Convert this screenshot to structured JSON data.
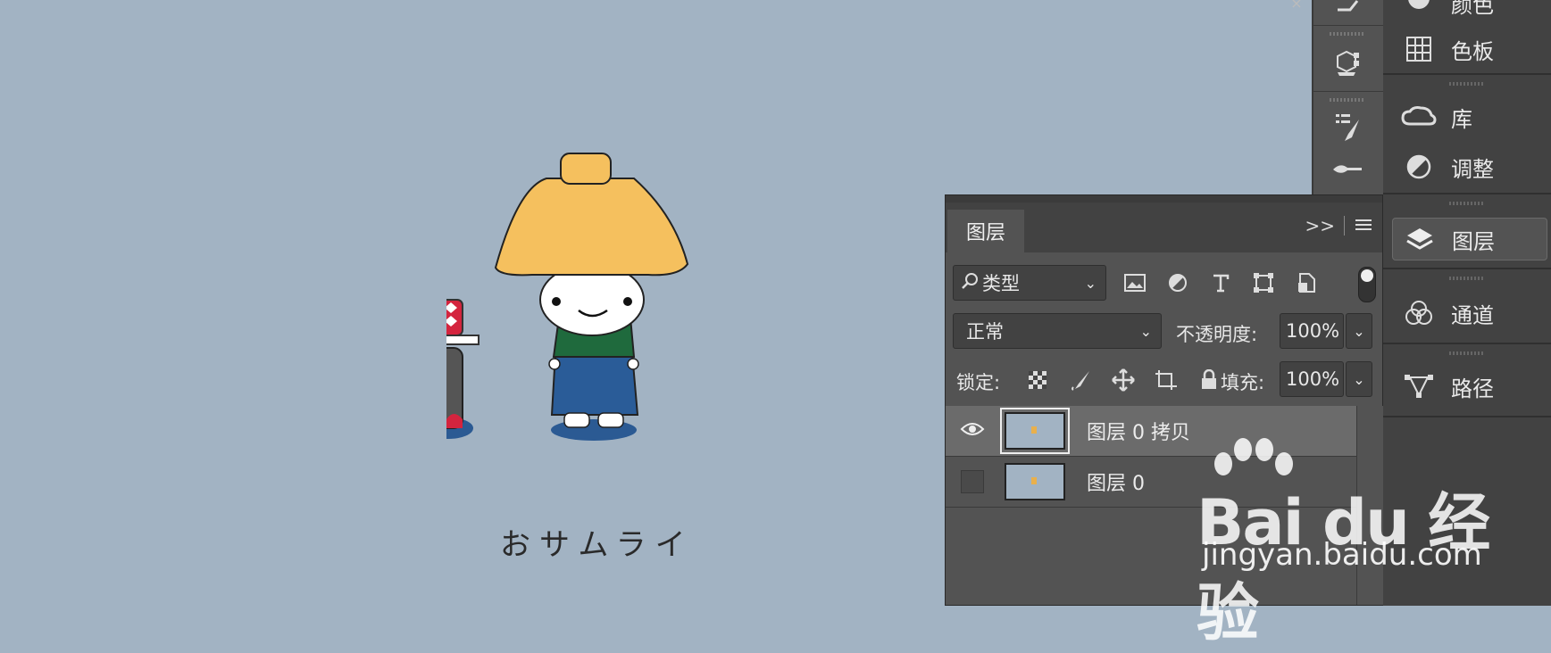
{
  "canvas": {
    "caption": "おサムライ"
  },
  "window": {
    "close_symbol": "×"
  },
  "side_panels": {
    "items": [
      {
        "label": "颜色",
        "icon": "color-icon"
      },
      {
        "label": "色板",
        "icon": "swatches-icon"
      },
      {
        "label": "库",
        "icon": "libraries-icon"
      },
      {
        "label": "调整",
        "icon": "adjustments-icon"
      },
      {
        "label": "图层",
        "icon": "layers-icon",
        "active": true
      },
      {
        "label": "通道",
        "icon": "channels-icon"
      },
      {
        "label": "路径",
        "icon": "paths-icon"
      }
    ]
  },
  "layers_panel": {
    "tab_label": "图层",
    "expand_symbol": ">>",
    "filter": {
      "label": "类型"
    },
    "blend_mode": "正常",
    "opacity_label": "不透明度:",
    "opacity_value": "100%",
    "lock_label": "锁定:",
    "fill_label": "填充:",
    "fill_value": "100%",
    "layers": [
      {
        "name": "图层 0 拷贝",
        "visible": true,
        "selected": true
      },
      {
        "name": "图层 0",
        "visible": false,
        "selected": false
      }
    ]
  },
  "watermark": {
    "brand": "Bai du 经验",
    "url": "jingyan.baidu.com"
  },
  "colors": {
    "canvas_bg": "#a2b3c3",
    "panel_bg": "#535353",
    "panel_dark": "#424242",
    "selected_row": "#6b6b6b"
  }
}
